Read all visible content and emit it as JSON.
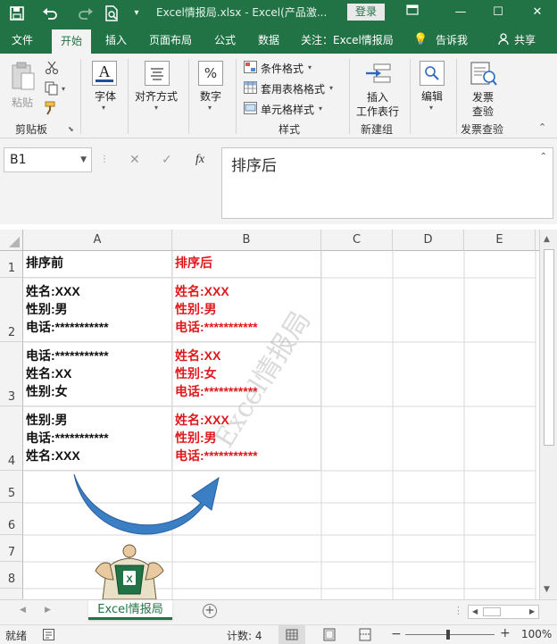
{
  "window": {
    "title": "Excel情报局.xlsx  -  Excel(产品激...",
    "login_label": "登录"
  },
  "ribbon_tabs": [
    "文件",
    "开始",
    "插入",
    "页面布局",
    "公式",
    "数据",
    "关注：Excel情报局",
    "告诉我",
    "共享"
  ],
  "ribbon": {
    "paste_label": "粘贴",
    "clipboard_group": "剪贴板",
    "font_label": "字体",
    "align_label": "对齐方式",
    "number_label": "数字",
    "cond_format": "条件格式",
    "table_format": "套用表格格式",
    "cell_style": "单元格样式",
    "styles_group": "样式",
    "insert_label_1": "插入",
    "insert_label_2": "工作表行",
    "new_group": "新建组",
    "edit_label": "编辑",
    "invoice_label_1": "发票",
    "invoice_label_2": "查验",
    "invoice_group": "发票查验"
  },
  "formula_bar": {
    "name_box": "B1",
    "fx": "fx",
    "content": "排序后"
  },
  "columns": [
    "A",
    "B",
    "C",
    "D",
    "E"
  ],
  "rows": [
    "1",
    "2",
    "3",
    "4",
    "5",
    "6",
    "7",
    "8"
  ],
  "cells": {
    "a1": "排序前",
    "b1": "排序后",
    "a2": "姓名:XXX\n性别:男\n电话:***********",
    "b2": "姓名:XXX\n性别:男\n电话:***********",
    "a3": "电话:***********\n姓名:XX\n性别:女",
    "b3": "姓名:XX\n性别:女\n电话:***********",
    "a4": "性别:男\n电话:***********\n姓名:XXX",
    "b4": "姓名:XXX\n性别:男\n电话:***********"
  },
  "watermark": "Excel情报局",
  "sheet_tab": "Excel情报局",
  "status": {
    "ready": "就绪",
    "count": "计数: 4",
    "zoom": "100%"
  },
  "colors": {
    "brand": "#217346",
    "red_text": "#e0181c",
    "arrow": "#3a7ec4"
  }
}
